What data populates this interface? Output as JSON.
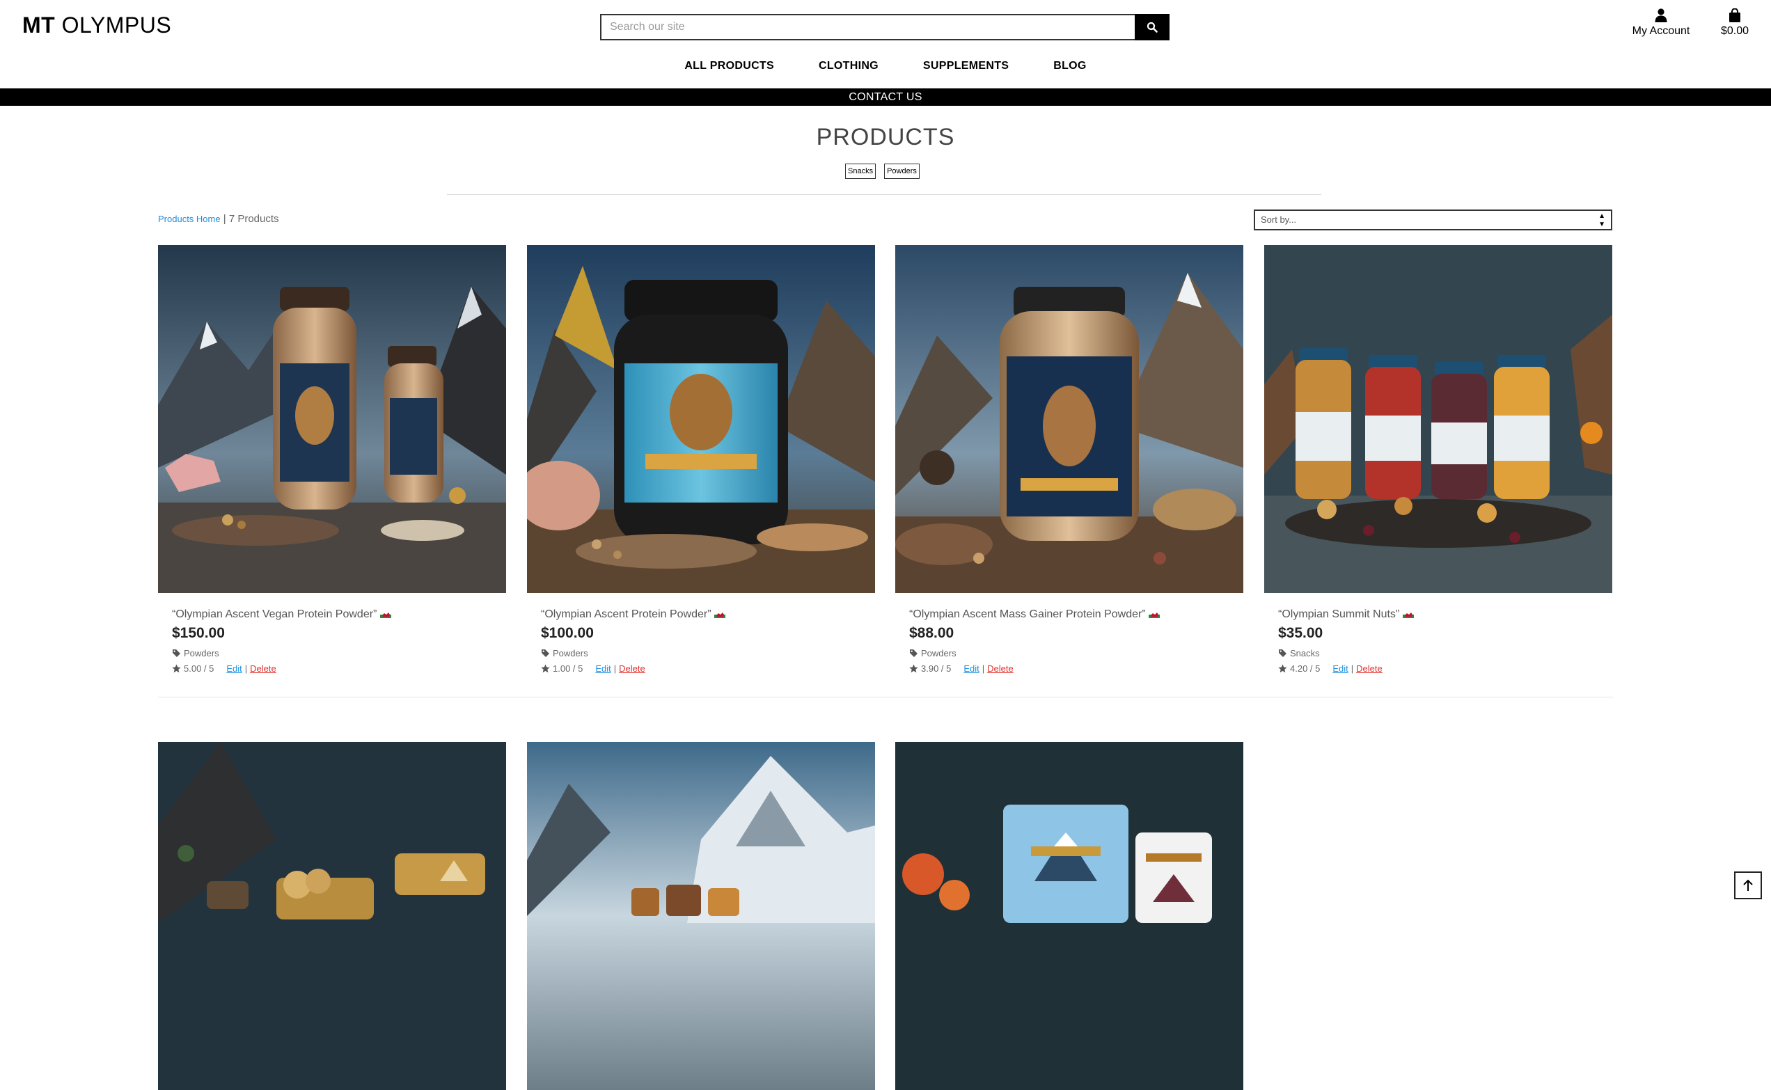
{
  "brand": {
    "bold": "MT",
    "regular": "OLYMPUS"
  },
  "search": {
    "placeholder": "Search our site"
  },
  "header": {
    "account_label": "My Account",
    "cart_total": "$0.00"
  },
  "nav": [
    "ALL PRODUCTS",
    "CLOTHING",
    "SUPPLEMENTS",
    "BLOG"
  ],
  "contact_bar": "CONTACT US",
  "page_title": "PRODUCTS",
  "filters": [
    "Snacks",
    "Powders"
  ],
  "breadcrumb": {
    "home": "Products Home",
    "sep": " | ",
    "count": "7 Products"
  },
  "sort": {
    "label": "Sort by..."
  },
  "products": [
    {
      "name": "“Olympian Ascent Vegan Protein Powder”",
      "price": "$150.00",
      "category": "Powders",
      "rating": "5.00 / 5",
      "edit": "Edit",
      "sep": "|",
      "delete": "Delete"
    },
    {
      "name": "“Olympian Ascent Protein Powder”",
      "price": "$100.00",
      "category": "Powders",
      "rating": "1.00 / 5",
      "edit": "Edit",
      "sep": "|",
      "delete": "Delete"
    },
    {
      "name": "“Olympian Ascent Mass Gainer Protein Powder”",
      "price": "$88.00",
      "category": "Powders",
      "rating": "3.90 / 5",
      "edit": "Edit",
      "sep": "|",
      "delete": "Delete"
    },
    {
      "name": "“Olympian Summit Nuts”",
      "price": "$35.00",
      "category": "Snacks",
      "rating": "4.20 / 5",
      "edit": "Edit",
      "sep": "|",
      "delete": "Delete"
    }
  ],
  "colors": {
    "accent_link": "#1e8fe0",
    "delete": "#e0312e",
    "bar": "#000000"
  }
}
